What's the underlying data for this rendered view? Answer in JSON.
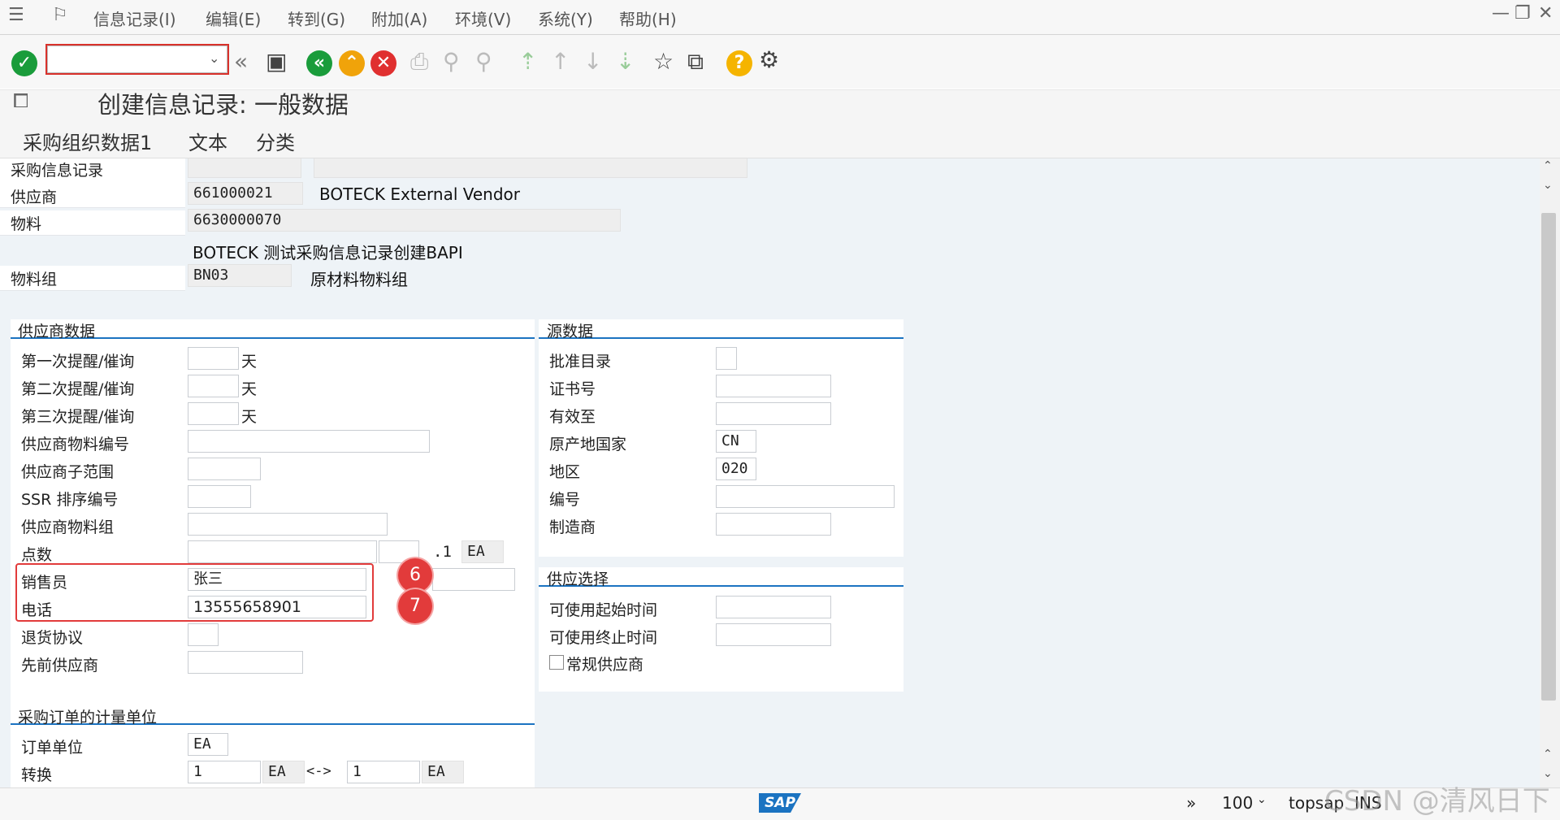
{
  "menu": {
    "items": [
      "信息记录(I)",
      "编辑(E)",
      "转到(G)",
      "附加(A)",
      "环境(V)",
      "系统(Y)",
      "帮助(H)"
    ]
  },
  "toolbar": {
    "command_value": "",
    "icons": [
      "check-icon",
      "back-double-icon",
      "save-icon",
      "back-icon",
      "exit-icon",
      "cancel-icon",
      "print-icon",
      "find-icon",
      "find-next-icon",
      "first-page-icon",
      "prev-page-icon",
      "next-page-icon",
      "last-page-icon",
      "create-session-icon",
      "shortcut-icon",
      "help-icon",
      "settings-icon"
    ],
    "help_glyph": "?"
  },
  "header": {
    "title": "创建信息记录: 一般数据"
  },
  "tabs": [
    "采购组织数据1",
    "文本",
    "分类"
  ],
  "top_fields": {
    "info_record_label": "采购信息记录",
    "vendor_label": "供应商",
    "vendor_value": "661000021",
    "vendor_name": "BOTECK External Vendor",
    "material_label": "物料",
    "material_value": "6630000070",
    "material_desc": "BOTECK 测试采购信息记录创建BAPI",
    "material_group_label": "物料组",
    "material_group_value": "BN03",
    "material_group_desc": "原材料物料组"
  },
  "vendor_data": {
    "header": "供应商数据",
    "rows": [
      {
        "label": "第一次提醒/催询",
        "value": "",
        "unit": "天"
      },
      {
        "label": "第二次提醒/催询",
        "value": "",
        "unit": "天"
      },
      {
        "label": "第三次提醒/催询",
        "value": "",
        "unit": "天"
      },
      {
        "label": "供应商物料编号",
        "value": ""
      },
      {
        "label": "供应商子范围",
        "value": ""
      },
      {
        "label": "SSR 排序编号",
        "value": ""
      },
      {
        "label": "供应商物料组",
        "value": ""
      },
      {
        "label": "点数",
        "value": "",
        "extra": ".1",
        "unit": "EA"
      },
      {
        "label": "销售员",
        "value": "张三"
      },
      {
        "label": "电话",
        "value": "13555658901"
      },
      {
        "label": "退货协议",
        "value": ""
      },
      {
        "label": "先前供应商",
        "value": ""
      }
    ]
  },
  "source_data": {
    "header": "源数据",
    "rows": [
      {
        "label": "批准目录",
        "value": ""
      },
      {
        "label": "证书号",
        "value": ""
      },
      {
        "label": "有效至",
        "value": ""
      },
      {
        "label": "原产地国家",
        "value": "CN"
      },
      {
        "label": "地区",
        "value": "020"
      },
      {
        "label": "编号",
        "value": ""
      },
      {
        "label": "制造商",
        "value": ""
      }
    ]
  },
  "supply_option": {
    "header": "供应选择",
    "rows": [
      {
        "label": "可使用起始时间",
        "value": ""
      },
      {
        "label": "可使用终止时间",
        "value": ""
      }
    ],
    "regular_vendor_label": "常规供应商"
  },
  "po_unit": {
    "header": "采购订单的计量单位",
    "order_unit_label": "订单单位",
    "order_unit_value": "EA",
    "conversion_label": "转换",
    "conv_left_value": "1",
    "conv_left_unit": "EA",
    "conv_arrow": "<->",
    "conv_right_value": "1",
    "conv_right_unit": "EA"
  },
  "annotations": {
    "badge_6": "6",
    "badge_7": "7"
  },
  "status": {
    "sap_logo": "SAP",
    "zoom": "100",
    "user": "topsap",
    "mode": "INS",
    "watermark": "CSDN @清风日下"
  },
  "colors": {
    "accent": "#1b73c1",
    "annotation": "#e23b3b",
    "ok_green": "#1a9c3b",
    "exit_orange": "#f0a30a",
    "cancel_red": "#e03030"
  }
}
